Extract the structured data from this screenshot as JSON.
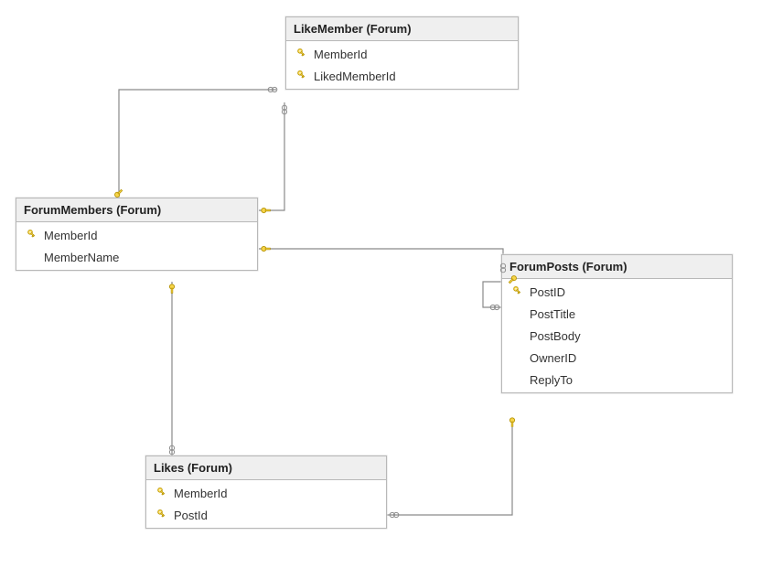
{
  "tables": {
    "likeMember": {
      "title": "LikeMember (Forum)",
      "columns": [
        {
          "name": "MemberId",
          "pk": true
        },
        {
          "name": "LikedMemberId",
          "pk": true
        }
      ]
    },
    "forumMembers": {
      "title": "ForumMembers (Forum)",
      "columns": [
        {
          "name": "MemberId",
          "pk": true
        },
        {
          "name": "MemberName",
          "pk": false
        }
      ]
    },
    "forumPosts": {
      "title": "ForumPosts (Forum)",
      "columns": [
        {
          "name": "PostID",
          "pk": true
        },
        {
          "name": "PostTitle",
          "pk": false
        },
        {
          "name": "PostBody",
          "pk": false
        },
        {
          "name": "OwnerID",
          "pk": false
        },
        {
          "name": "ReplyTo",
          "pk": false
        }
      ]
    },
    "likes": {
      "title": "Likes (Forum)",
      "columns": [
        {
          "name": "MemberId",
          "pk": true
        },
        {
          "name": "PostId",
          "pk": true
        }
      ]
    }
  },
  "relationships": [
    {
      "from": "ForumMembers",
      "to": "LikeMember",
      "via": "MemberId",
      "type": "one-to-many"
    },
    {
      "from": "ForumMembers",
      "to": "LikeMember",
      "via": "LikedMemberId",
      "type": "one-to-many"
    },
    {
      "from": "ForumMembers",
      "to": "ForumPosts",
      "via": "OwnerID",
      "type": "one-to-many"
    },
    {
      "from": "ForumMembers",
      "to": "Likes",
      "via": "MemberId",
      "type": "one-to-many"
    },
    {
      "from": "ForumPosts",
      "to": "Likes",
      "via": "PostId",
      "type": "one-to-many"
    },
    {
      "from": "ForumPosts",
      "to": "ForumPosts",
      "via": "ReplyTo",
      "type": "self-one-to-many"
    }
  ]
}
